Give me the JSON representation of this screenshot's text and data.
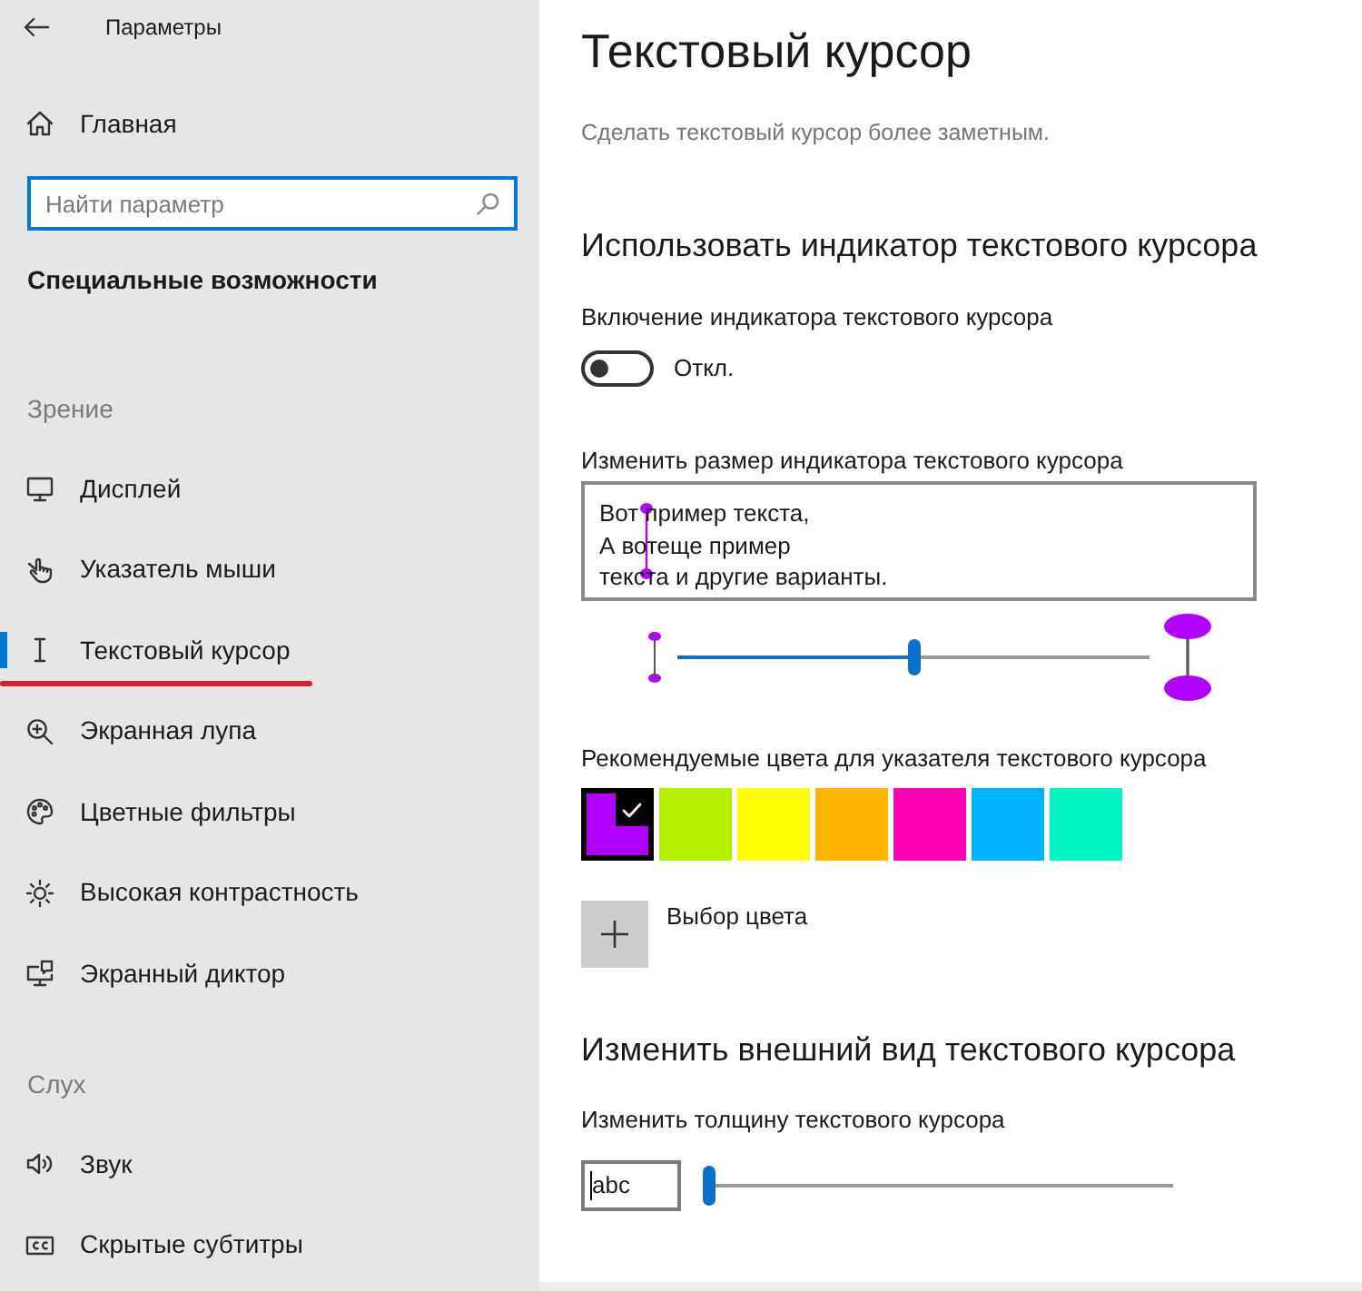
{
  "window": {
    "title": "Параметры"
  },
  "sidebar": {
    "home": {
      "label": "Главная"
    },
    "search": {
      "placeholder": "Найти параметр"
    },
    "category": "Специальные возможности",
    "sections": [
      {
        "heading": "Зрение",
        "items": [
          {
            "label": "Дисплей",
            "selected": false,
            "underlined": false
          },
          {
            "label": "Указатель мыши",
            "selected": false,
            "underlined": false
          },
          {
            "label": "Текстовый курсор",
            "selected": true,
            "underlined": true
          },
          {
            "label": "Экранная лупа",
            "selected": false,
            "underlined": false
          },
          {
            "label": "Цветные фильтры",
            "selected": false,
            "underlined": false
          },
          {
            "label": "Высокая контрастность",
            "selected": false,
            "underlined": false
          },
          {
            "label": "Экранный диктор",
            "selected": false,
            "underlined": false
          }
        ]
      },
      {
        "heading": "Слух",
        "items": [
          {
            "label": "Звук",
            "selected": false,
            "underlined": false
          },
          {
            "label": "Скрытые субтитры",
            "selected": false,
            "underlined": false
          }
        ]
      }
    ]
  },
  "page": {
    "title": "Текстовый курсор",
    "description": "Сделать текстовый курсор более заметным.",
    "indicator": {
      "heading": "Использовать индикатор текстового курсора",
      "toggle": {
        "label": "Включение индикатора текстового курсора",
        "on": false,
        "state_text": "Откл."
      },
      "size": {
        "label": "Изменить размер индикатора текстового курсора",
        "preview_lines": [
          "Вот пример текста,",
          "А вотеще пример",
          "текста и другие варианты."
        ],
        "level": 0.5
      },
      "colors": {
        "label": "Рекомендуемые цвета для указателя текстового курсора",
        "swatches": [
          {
            "color": "#b000ff",
            "selected": true
          },
          {
            "color": "#b4f000",
            "selected": false
          },
          {
            "color": "#ffff00",
            "selected": false
          },
          {
            "color": "#ffb400",
            "selected": false
          },
          {
            "color": "#ff00b4",
            "selected": false
          },
          {
            "color": "#00b4ff",
            "selected": false
          },
          {
            "color": "#00f5c0",
            "selected": false
          }
        ],
        "custom_color": {
          "label": "Выбор цвета"
        }
      }
    },
    "appearance": {
      "heading": "Изменить внешний вид текстового курсора",
      "thickness": {
        "label": "Изменить толщину текстового курсора",
        "preview_text": "abc",
        "level": 0
      }
    }
  }
}
